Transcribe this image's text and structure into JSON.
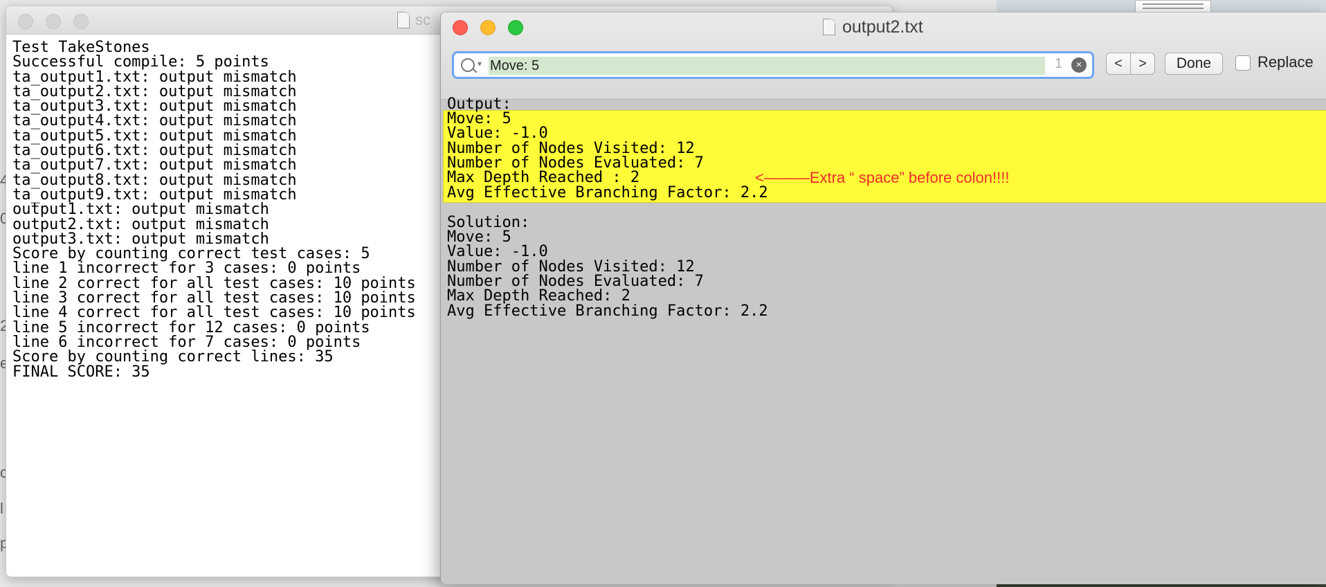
{
  "back_window": {
    "title": "sc",
    "lines": [
      "Test TakeStones",
      "Successful compile: 5 points",
      "ta_output1.txt: output mismatch",
      "ta_output2.txt: output mismatch",
      "ta_output3.txt: output mismatch",
      "ta_output4.txt: output mismatch",
      "ta_output5.txt: output mismatch",
      "ta_output6.txt: output mismatch",
      "ta_output7.txt: output mismatch",
      "ta_output8.txt: output mismatch",
      "ta_output9.txt: output mismatch",
      "output1.txt: output mismatch",
      "output2.txt: output mismatch",
      "output3.txt: output mismatch",
      "Score by counting correct test cases: 5",
      "line 1 incorrect for 3 cases: 0 points",
      "line 2 correct for all test cases: 10 points",
      "line 3 correct for all test cases: 10 points",
      "line 4 correct for all test cases: 10 points",
      "line 5 incorrect for 12 cases: 0 points",
      "line 6 incorrect for 7 cases: 0 points",
      "Score by counting correct lines: 35",
      "FINAL SCORE: 35"
    ]
  },
  "front_window": {
    "title": "output2.txt",
    "find": {
      "value": "Move: 5",
      "match_count": "1",
      "prev": "<",
      "next": ">",
      "done": "Done",
      "replace": "Replace"
    },
    "output_header": "Output:",
    "output_lines": [
      "Move: 5",
      "Value: -1.0",
      "Number of Nodes Visited: 12",
      "Number of Nodes Evaluated: 7",
      "Max Depth Reached : 2",
      "Avg Effective Branching Factor: 2.2"
    ],
    "annotation": "<———Extra “ space” before colon!!!!",
    "solution_header": "Solution:",
    "solution_lines": [
      "Move: 5",
      "Value: -1.0",
      "Number of Nodes Visited: 12",
      "Number of Nodes Evaluated: 7",
      "Max Depth Reached: 2",
      "Avg Effective Branching Factor: 2.2"
    ],
    "highlight_color": "#fffb38",
    "annotation_color": "#ef2d2d"
  }
}
